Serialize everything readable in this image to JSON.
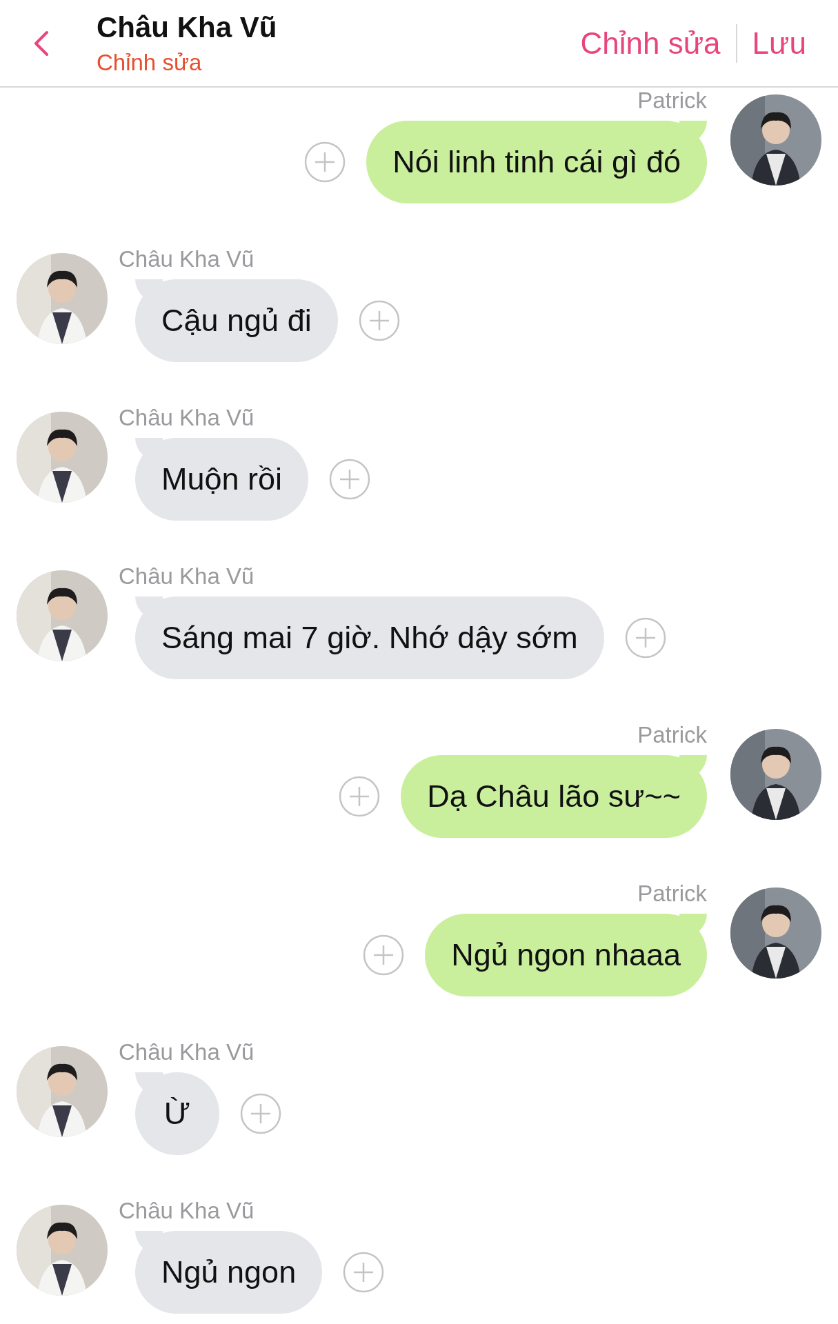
{
  "header": {
    "title": "Châu Kha Vũ",
    "subtitle": "Chỉnh sửa",
    "actions": [
      "Chỉnh sửa",
      "Lưu"
    ]
  },
  "messages": [
    {
      "kind": "outgoing",
      "sender": "Patrick",
      "text": "Nói linh tinh cái gì đó"
    },
    {
      "kind": "incoming",
      "sender": "Châu Kha Vũ",
      "text": "Cậu ngủ đi"
    },
    {
      "kind": "incoming",
      "sender": "Châu Kha Vũ",
      "text": "Muộn rồi"
    },
    {
      "kind": "incoming",
      "sender": "Châu Kha Vũ",
      "text": "Sáng mai 7 giờ. Nhớ dậy sớm"
    },
    {
      "kind": "outgoing",
      "sender": "Patrick",
      "text": "Dạ Châu lão sư~~"
    },
    {
      "kind": "outgoing",
      "sender": "Patrick",
      "text": "Ngủ ngon nhaaa"
    },
    {
      "kind": "incoming",
      "sender": "Châu Kha Vũ",
      "text": "Ừ"
    },
    {
      "kind": "incoming",
      "sender": "Châu Kha Vũ",
      "text": "Ngủ ngon"
    }
  ]
}
